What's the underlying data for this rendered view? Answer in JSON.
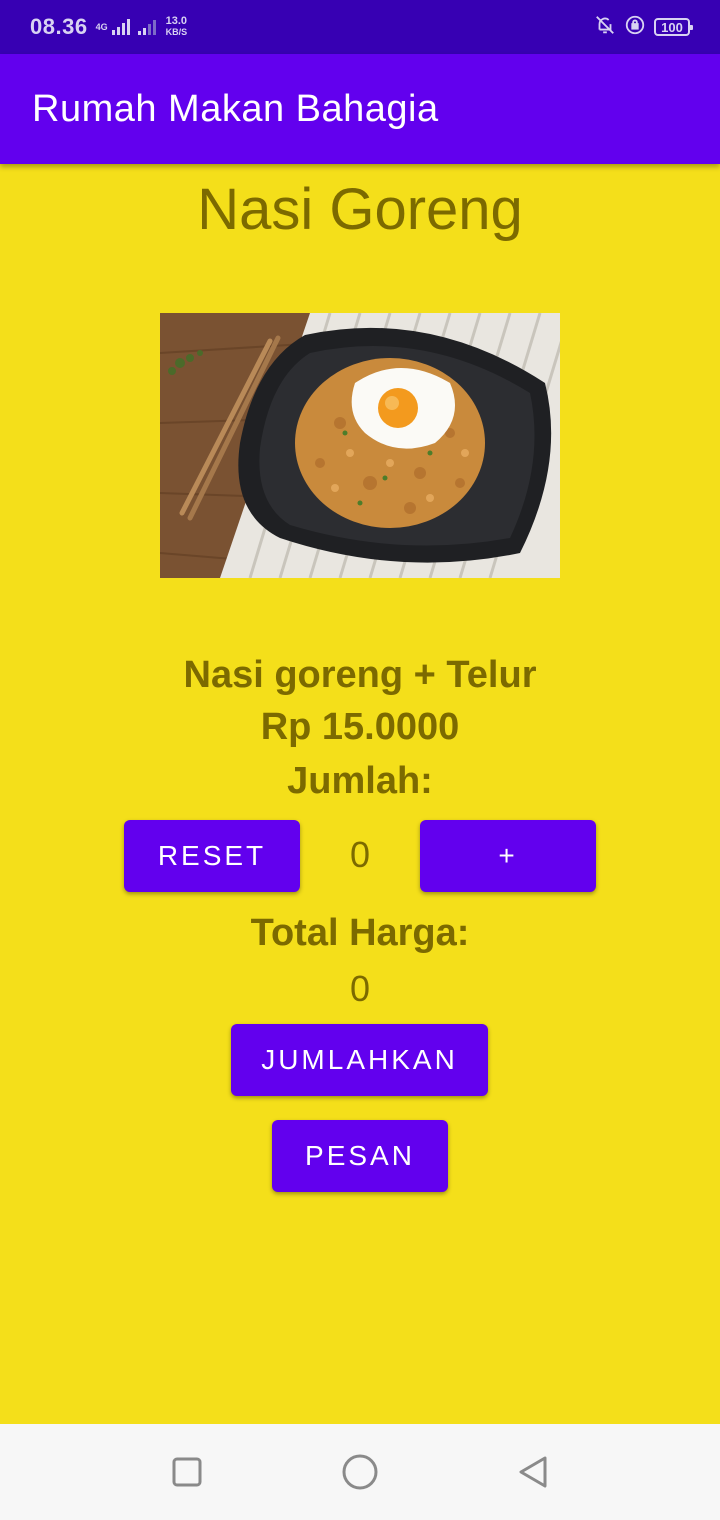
{
  "status_bar": {
    "time": "08.36",
    "network_type": "4G",
    "speed_value": "13.0",
    "speed_unit": "KB/S",
    "battery": "100",
    "icons": [
      "signal-icon",
      "signal-icon",
      "alarm-off-icon",
      "rotation-lock-icon",
      "battery-icon"
    ]
  },
  "app_bar": {
    "title": "Rumah Makan Bahagia"
  },
  "dish": {
    "title": "Nasi Goreng",
    "image_icon": "nasi-goreng-photo",
    "description": "Nasi goreng + Telur",
    "price": "Rp 15.0000"
  },
  "quantity": {
    "label": "Jumlah:",
    "reset_label": "RESET",
    "value": "0",
    "plus_label": "+"
  },
  "total": {
    "label": "Total Harga:",
    "value": "0"
  },
  "actions": {
    "sum_label": "JUMLAHKAN",
    "order_label": "PESAN"
  },
  "nav_bar": {
    "icons": [
      "recents-square-icon",
      "home-circle-icon",
      "back-triangle-icon"
    ]
  },
  "colors": {
    "background": "#f4df1a",
    "primary": "#6200ee",
    "primary_dark": "#3700b3",
    "text": "#7c6a00"
  }
}
